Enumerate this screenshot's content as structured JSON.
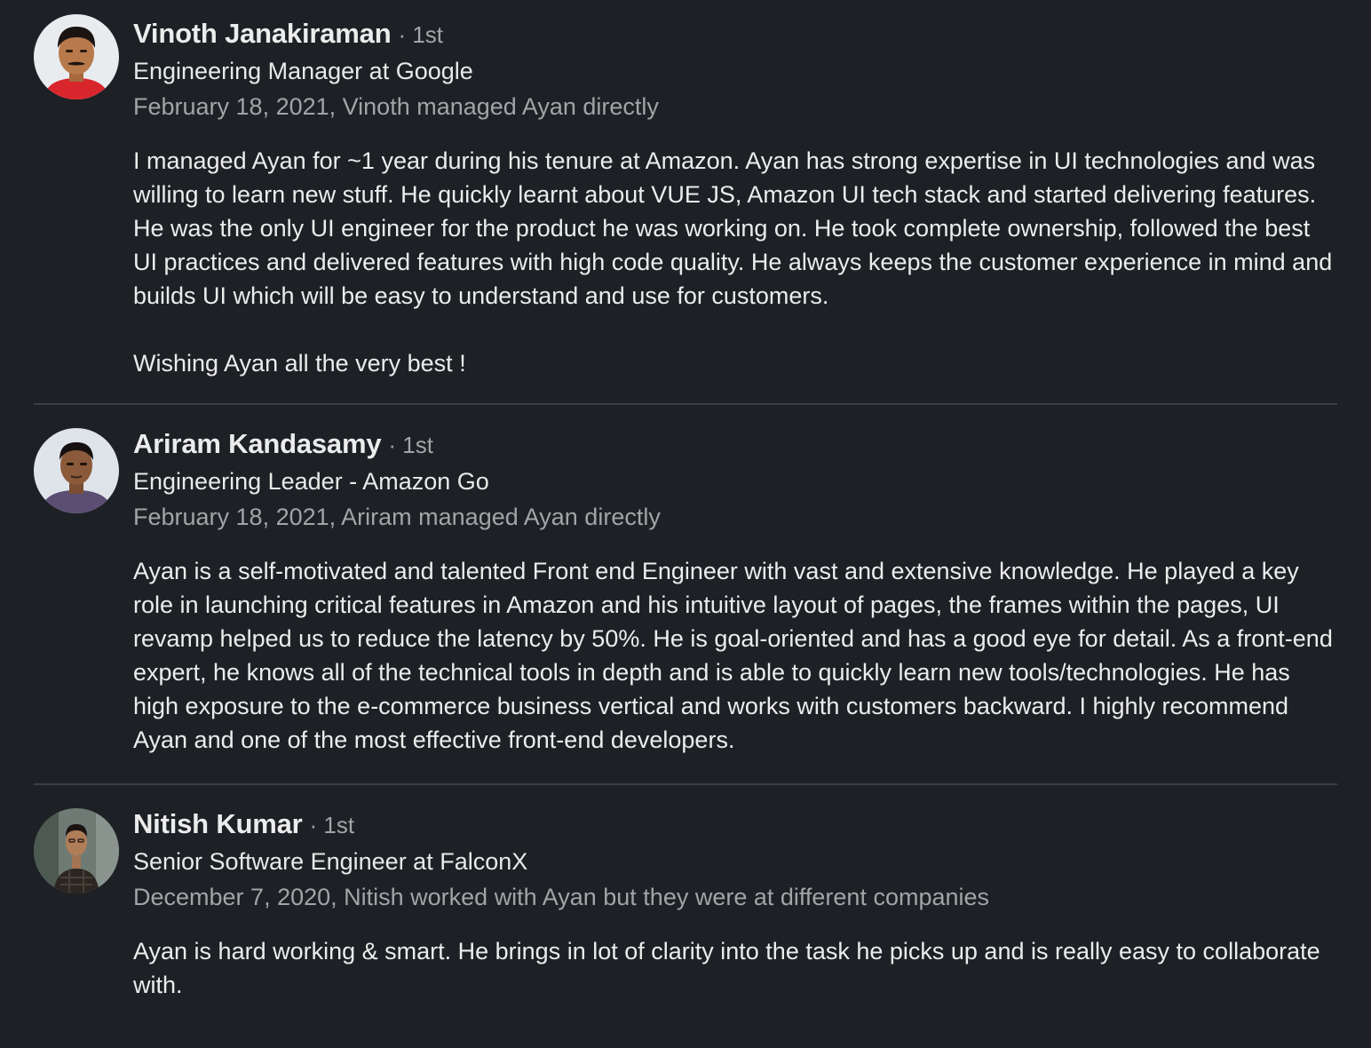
{
  "recommendations": [
    {
      "name": "Vinoth Janakiraman",
      "degree": "· 1st",
      "headline": "Engineering Manager at Google",
      "meta": "February 18, 2021, Vinoth managed Ayan directly",
      "paragraphs": [
        "I managed Ayan for ~1 year during his tenure at Amazon. Ayan has strong expertise in UI technologies and was willing to learn new stuff. He quickly learnt about VUE JS, Amazon UI tech stack and started delivering features. He was the only UI engineer for the product he was working on. He took complete ownership, followed the best UI practices and delivered features with high code quality. He always keeps the customer experience in mind and builds UI which will be easy to understand and use for customers.",
        "Wishing Ayan all the very best !"
      ]
    },
    {
      "name": "Ariram Kandasamy",
      "degree": "· 1st",
      "headline": "Engineering Leader - Amazon Go",
      "meta": "February 18, 2021, Ariram managed Ayan directly",
      "paragraphs": [
        "Ayan is a self-motivated and talented Front end Engineer with vast and extensive knowledge. He played a key role in launching critical features in Amazon and his intuitive layout of pages, the frames within the pages, UI revamp helped us to reduce the latency by 50%. He is goal-oriented and has a good eye for detail. As a front-end expert, he knows all of the technical tools in depth and is able to quickly learn new tools/technologies. He has high exposure to the e-commerce business vertical and works with customers backward. I highly recommend Ayan and one of the most effective front-end developers."
      ]
    },
    {
      "name": "Nitish Kumar",
      "degree": "· 1st",
      "headline": "Senior Software Engineer at FalconX",
      "meta": "December 7, 2020, Nitish worked with Ayan but they were at different companies",
      "paragraphs": [
        "Ayan is hard working & smart. He brings in lot of clarity into the task he picks up and is really easy to collaborate with."
      ]
    }
  ]
}
